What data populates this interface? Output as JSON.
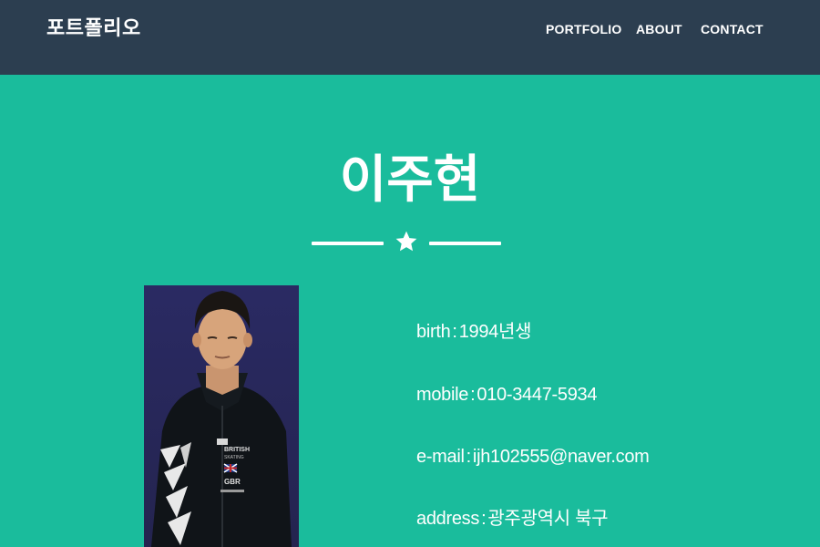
{
  "navbar": {
    "brand": "포트폴리오",
    "links": [
      {
        "label": "PORTFOLIO"
      },
      {
        "label": "ABOUT"
      },
      {
        "label": "CONTACT"
      }
    ]
  },
  "masthead": {
    "name": "이주현",
    "divider_icon": "star-icon",
    "photo_text": {
      "line1": "BRITISH",
      "line2": "SKATING",
      "line3": "GBR"
    },
    "info": {
      "birth": {
        "label": "birth",
        "value": "1994년생"
      },
      "mobile": {
        "label": "mobile",
        "value": "010-3447-5934"
      },
      "email": {
        "label": "e-mail",
        "value": "ijh102555@naver.com"
      },
      "address": {
        "label": "address",
        "value": "광주광역시 북구"
      }
    }
  },
  "colors": {
    "navbar_bg": "#2c3e50",
    "masthead_bg": "#1abc9c",
    "text": "#ffffff"
  }
}
